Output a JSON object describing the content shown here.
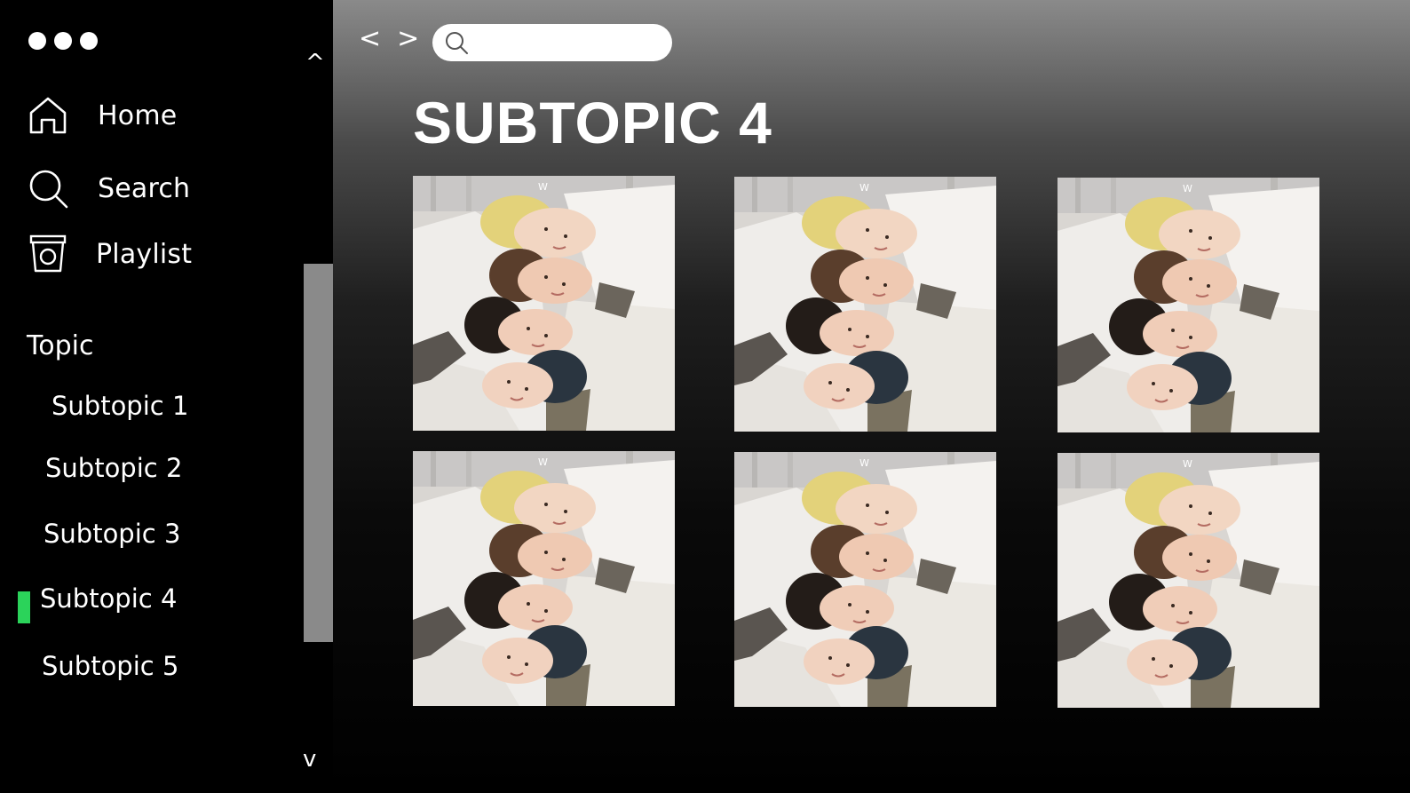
{
  "sidebar": {
    "nav": [
      {
        "label": "Home",
        "icon": "home-icon"
      },
      {
        "label": "Search",
        "icon": "search-icon"
      },
      {
        "label": "Playlist",
        "icon": "playlist-icon"
      }
    ],
    "topic_heading": "Topic",
    "subtopics": [
      {
        "label": "Subtopic 1"
      },
      {
        "label": "Subtopic 2"
      },
      {
        "label": "Subtopic 3"
      },
      {
        "label": "Subtopic 4",
        "active": true
      },
      {
        "label": "Subtopic 5"
      }
    ],
    "scroll_up": "^",
    "scroll_down": "v",
    "active_color": "#2bd35a"
  },
  "header": {
    "back": "<",
    "forward": ">",
    "search_value": ""
  },
  "main": {
    "title": "SUBTOPIC 4",
    "tiles": [
      {
        "icon": "album-cover-photo"
      },
      {
        "icon": "album-cover-photo"
      },
      {
        "icon": "album-cover-photo"
      },
      {
        "icon": "album-cover-photo"
      },
      {
        "icon": "album-cover-photo"
      },
      {
        "icon": "album-cover-photo"
      }
    ]
  }
}
